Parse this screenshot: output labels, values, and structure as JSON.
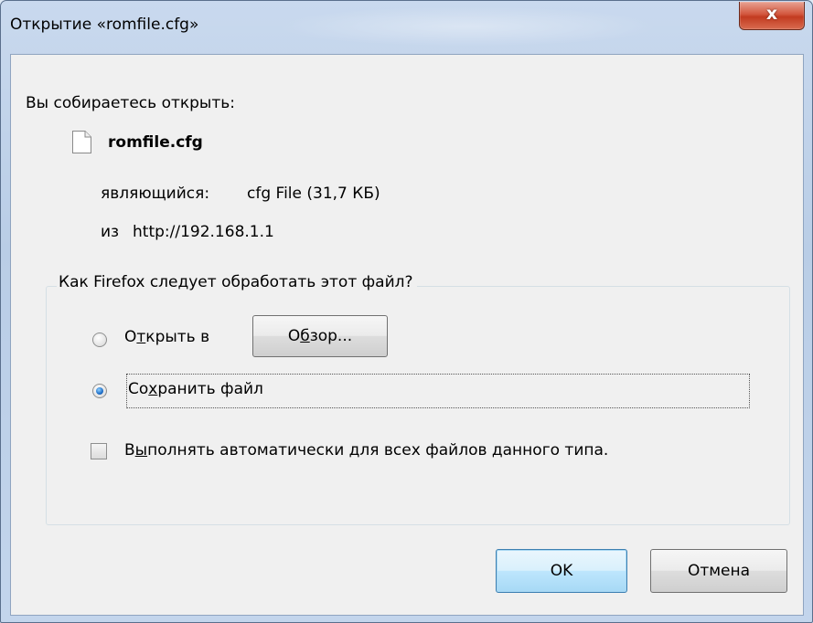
{
  "window": {
    "title": "Открытие «romfile.cfg»",
    "close_symbol": "x"
  },
  "intro": "Вы собираетесь открыть:",
  "file": {
    "icon": "document-icon",
    "name": "romfile.cfg",
    "type_label": "являющийся:",
    "type_value": "cfg File (31,7 КБ)",
    "from_label": "из",
    "from_value": "http://192.168.1.1"
  },
  "handling": {
    "legend": "Как Firefox следует обработать этот файл?",
    "open_with": {
      "pre": "О",
      "accel": "т",
      "post": "крыть в",
      "selected": false
    },
    "browse_button": {
      "pre": "О",
      "accel": "б",
      "post": "зор..."
    },
    "save_file": {
      "pre": "Со",
      "accel": "х",
      "post": "ранить файл",
      "selected": true
    },
    "auto": {
      "pre": "В",
      "accel": "ы",
      "post": "полнять автоматически для всех файлов данного типа.",
      "checked": false
    }
  },
  "buttons": {
    "ok": "OK",
    "cancel": "Отмена"
  }
}
